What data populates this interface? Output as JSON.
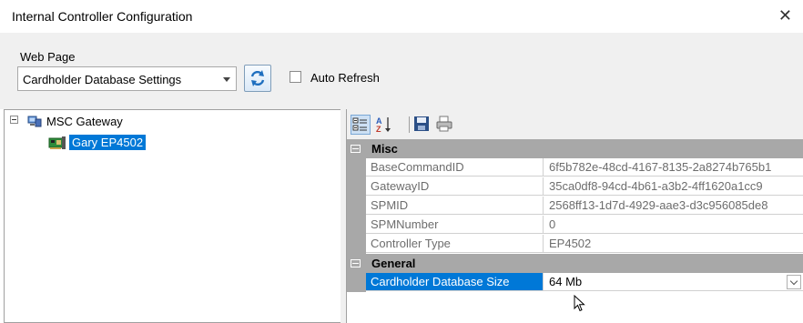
{
  "window": {
    "title": "Internal Controller Configuration"
  },
  "top_panel": {
    "web_page_label": "Web Page",
    "web_page_selected": "Cardholder Database Settings",
    "auto_refresh_label": "Auto Refresh",
    "auto_refresh_checked": false
  },
  "tree": {
    "root_label": "MSC Gateway",
    "child_label": "Gary EP4502"
  },
  "property_grid": {
    "categories": [
      {
        "label": "Misc",
        "rows": [
          {
            "name": "BaseCommandID",
            "value": "6f5b782e-48cd-4167-8135-2a8274b765b1"
          },
          {
            "name": "GatewayID",
            "value": "35ca0df8-94cd-4b61-a3b2-4ff1620a1cc9"
          },
          {
            "name": "SPMID",
            "value": "2568ff13-1d7d-4929-aae3-d3c956085de8"
          },
          {
            "name": "SPMNumber",
            "value": "0"
          },
          {
            "name": "Controller Type",
            "value": "EP4502"
          }
        ]
      },
      {
        "label": "General",
        "rows": [
          {
            "name": "Cardholder Database Size",
            "value": "64 Mb"
          }
        ]
      }
    ]
  },
  "colors": {
    "selection": "#0078d7",
    "category": "#a8a8a8",
    "panel": "#f0f0f0"
  }
}
